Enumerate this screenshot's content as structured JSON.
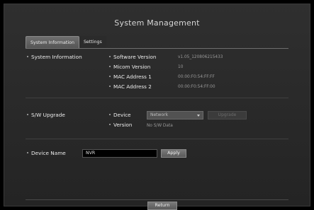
{
  "title": "System Management",
  "tabs": [
    {
      "label": "System Information",
      "active": true
    },
    {
      "label": "Settings",
      "active": false
    }
  ],
  "system_information": {
    "section_label": "System Information",
    "rows": [
      {
        "label": "Software Version",
        "value": "v1.05_120806215433"
      },
      {
        "label": "Micom Version",
        "value": "10"
      },
      {
        "label": "MAC Address 1",
        "value": "00:00:F0:54:FF:FF"
      },
      {
        "label": "MAC Address 2",
        "value": "00:00:F0:54:FF:00"
      }
    ]
  },
  "sw_upgrade": {
    "section_label": "S/W Upgrade",
    "device_label": "Device",
    "device_value": "Network",
    "upgrade_button": "Upgrade",
    "version_label": "Version",
    "version_value": "No S/W Data"
  },
  "device_name": {
    "section_label": "Device Name",
    "value": "NVR",
    "apply_button": "Apply"
  },
  "return_button": "Return",
  "colors": {
    "background": "#000000",
    "panel": "#2a2a2a",
    "label_text": "#ececec",
    "value_text": "#9a9a9a"
  }
}
